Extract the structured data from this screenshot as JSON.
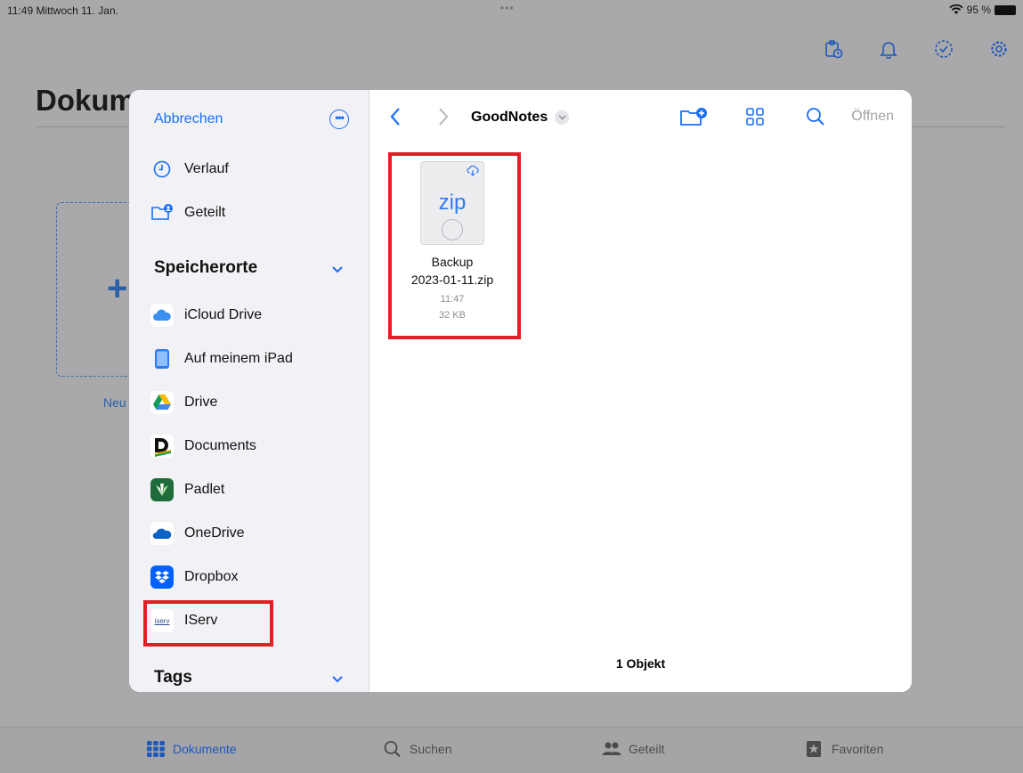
{
  "status_bar": {
    "time_date": "11:49  Mittwoch 11. Jan.",
    "dots": "•••",
    "battery": "95 %"
  },
  "background": {
    "title": "Dokum",
    "new_label": "Neu",
    "plus": "+"
  },
  "tab_bar": [
    {
      "label": "Dokumente",
      "icon": "grid-icon",
      "active": true
    },
    {
      "label": "Suchen",
      "icon": "search-icon",
      "active": false
    },
    {
      "label": "Geteilt",
      "icon": "people-icon",
      "active": false
    },
    {
      "label": "Favoriten",
      "icon": "star-icon",
      "active": false
    }
  ],
  "sidebar": {
    "cancel": "Abbrechen",
    "more": "•••",
    "top_items": [
      {
        "label": "Verlauf",
        "icon": "clock-icon"
      },
      {
        "label": "Geteilt",
        "icon": "shared-folder-icon"
      }
    ],
    "locations_header": "Speicherorte",
    "locations": [
      {
        "label": "iCloud Drive",
        "icon": "icloud-icon"
      },
      {
        "label": "Auf meinem iPad",
        "icon": "ipad-icon"
      },
      {
        "label": "Drive",
        "icon": "google-drive-icon"
      },
      {
        "label": "Documents",
        "icon": "documents-icon"
      },
      {
        "label": "Padlet",
        "icon": "padlet-icon"
      },
      {
        "label": "OneDrive",
        "icon": "onedrive-icon"
      },
      {
        "label": "Dropbox",
        "icon": "dropbox-icon"
      },
      {
        "label": "IServ",
        "icon": "iserv-icon",
        "icon_text": "iserv"
      }
    ],
    "tags_header": "Tags"
  },
  "browser": {
    "folder_title": "GoodNotes",
    "open_label": "Öffnen",
    "file": {
      "name_line1": "Backup",
      "name_line2": "2023-01-11.zip",
      "time": "11:47",
      "size": "32 KB",
      "badge": "zip"
    },
    "count": "1 Objekt"
  },
  "colors": {
    "accent": "#1a6ef5",
    "highlight": "#e31e25",
    "dim_bg": "#a9a9ab"
  }
}
